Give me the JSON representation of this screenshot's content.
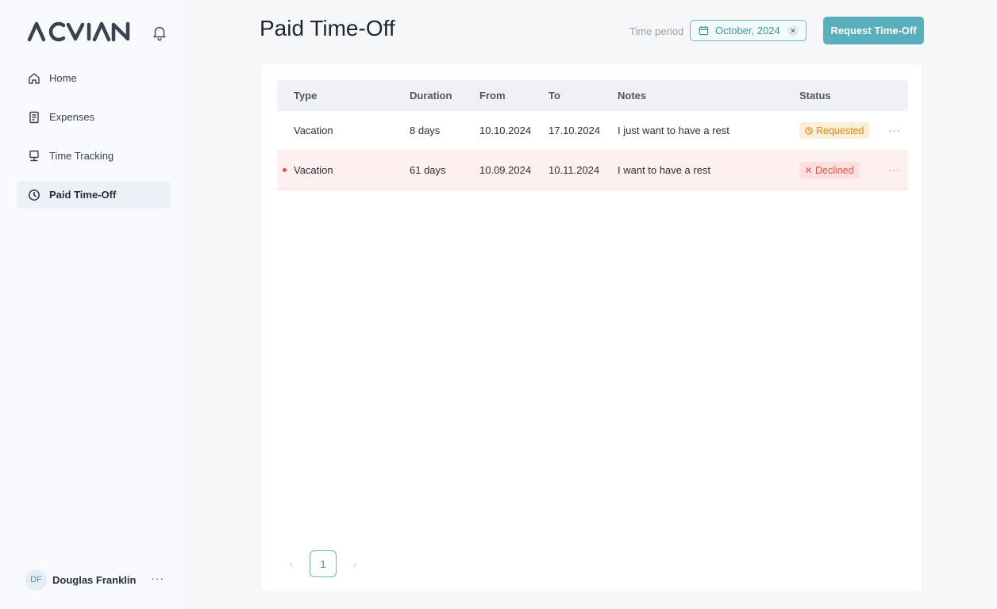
{
  "brand": {
    "logo_text": "ACVIAN"
  },
  "sidebar": {
    "items": [
      {
        "label": "Home",
        "icon": "home-icon",
        "active": false
      },
      {
        "label": "Expenses",
        "icon": "receipt-icon",
        "active": false
      },
      {
        "label": "Time Tracking",
        "icon": "monitor-icon",
        "active": false
      },
      {
        "label": "Paid Time-Off",
        "icon": "clock-icon",
        "active": true
      }
    ]
  },
  "user": {
    "initials": "DF",
    "name": "Douglas Franklin",
    "more": "···"
  },
  "header": {
    "title": "Paid Time-Off",
    "period_label": "Time period",
    "period_value": "October, 2024",
    "request_button": "Request Time-Off"
  },
  "table": {
    "columns": [
      "Type",
      "Duration",
      "From",
      "To",
      "Notes",
      "Status"
    ],
    "rows": [
      {
        "type": "Vacation",
        "duration": "8 days",
        "from": "10.10.2024",
        "to": "17.10.2024",
        "notes": "I just want to have a rest",
        "status": "Requested",
        "more": "···"
      },
      {
        "type": "Vacation",
        "duration": "61 days",
        "from": "10.09.2024",
        "to": "10.11.2024",
        "notes": "I want to have a rest",
        "status": "Declined",
        "more": "···"
      }
    ]
  },
  "pagination": {
    "prev": "‹",
    "current": "1",
    "next": "›"
  },
  "colors": {
    "accent": "#5aafbd",
    "requested": "#d68a19",
    "declined": "#de5a4a"
  }
}
